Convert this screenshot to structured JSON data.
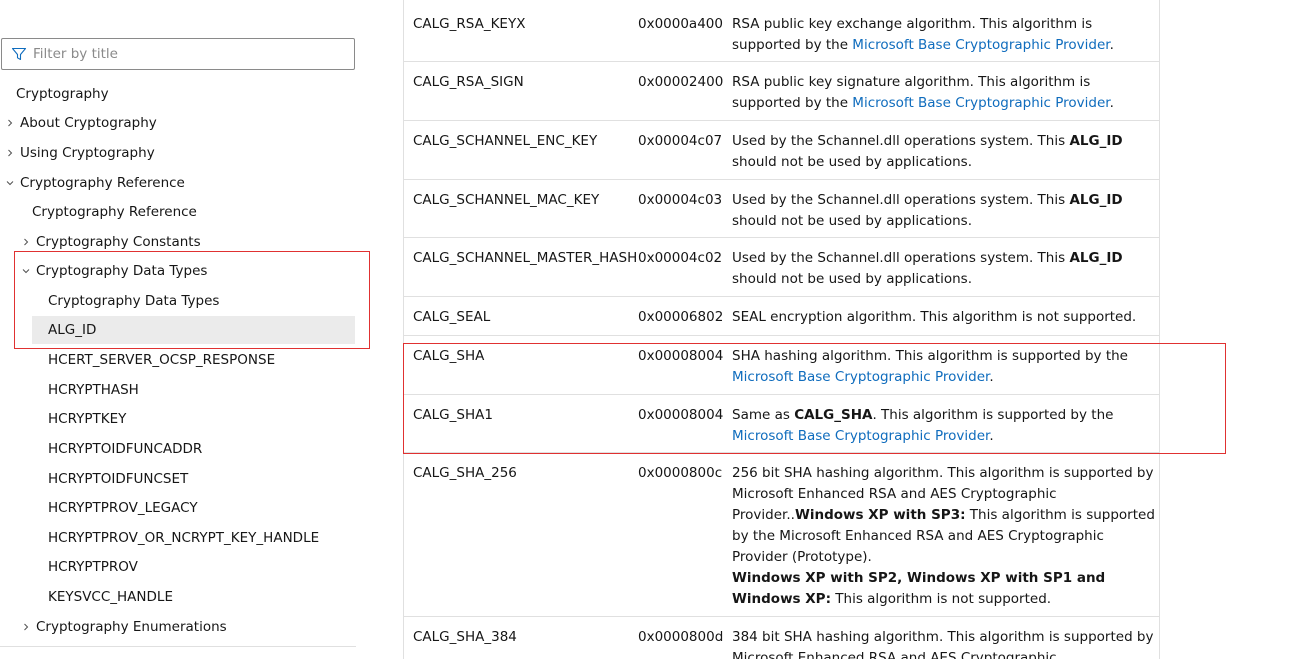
{
  "sidebar": {
    "filter_placeholder": "Filter by title",
    "items": [
      {
        "label": "Cryptography",
        "chevron": "none"
      },
      {
        "label": "About Cryptography",
        "chevron": "right"
      },
      {
        "label": "Using Cryptography",
        "chevron": "right"
      },
      {
        "label": "Cryptography Reference",
        "chevron": "down"
      },
      {
        "label": "Cryptography Reference",
        "chevron": "none"
      },
      {
        "label": "Cryptography Constants",
        "chevron": "right"
      },
      {
        "label": "Cryptography Data Types",
        "chevron": "down"
      },
      {
        "label": "Cryptography Data Types",
        "chevron": "none"
      },
      {
        "label": "ALG_ID",
        "chevron": "none",
        "selected": true
      },
      {
        "label": "HCERT_SERVER_OCSP_RESPONSE",
        "chevron": "none"
      },
      {
        "label": "HCRYPTHASH",
        "chevron": "none"
      },
      {
        "label": "HCRYPTKEY",
        "chevron": "none"
      },
      {
        "label": "HCRYPTOIDFUNCADDR",
        "chevron": "none"
      },
      {
        "label": "HCRYPTOIDFUNCSET",
        "chevron": "none"
      },
      {
        "label": "HCRYPTPROV_LEGACY",
        "chevron": "none"
      },
      {
        "label": "HCRYPTPROV_OR_NCRYPT_KEY_HANDLE",
        "chevron": "none"
      },
      {
        "label": "HCRYPTPROV",
        "chevron": "none"
      },
      {
        "label": "KEYSVCC_HANDLE",
        "chevron": "none"
      },
      {
        "label": "Cryptography Enumerations",
        "chevron": "right"
      }
    ]
  },
  "table": {
    "rows": [
      {
        "name": "CALG_RSA_KEYX",
        "value": "0x0000a400",
        "desc": [
          {
            "t": "RSA public key exchange algorithm. This algorithm is supported by the "
          },
          {
            "t": "Microsoft Base Cryptographic Provider",
            "link": true
          },
          {
            "t": "."
          }
        ]
      },
      {
        "name": "CALG_RSA_SIGN",
        "value": "0x00002400",
        "desc": [
          {
            "t": "RSA public key signature algorithm. This algorithm is supported by the "
          },
          {
            "t": "Microsoft Base Cryptographic Provider",
            "link": true
          },
          {
            "t": "."
          }
        ]
      },
      {
        "name": "CALG_SCHANNEL_ENC_KEY",
        "value": "0x00004c07",
        "desc": [
          {
            "t": "Used by the Schannel.dll operations system. This "
          },
          {
            "t": "ALG_ID",
            "bold": true
          },
          {
            "t": " should not be used by applications."
          }
        ]
      },
      {
        "name": "CALG_SCHANNEL_MAC_KEY",
        "value": "0x00004c03",
        "desc": [
          {
            "t": "Used by the Schannel.dll operations system. This "
          },
          {
            "t": "ALG_ID",
            "bold": true
          },
          {
            "t": " should not be used by applications."
          }
        ]
      },
      {
        "name": "CALG_SCHANNEL_MASTER_HASH",
        "value": "0x00004c02",
        "desc": [
          {
            "t": "Used by the Schannel.dll operations system. This "
          },
          {
            "t": "ALG_ID",
            "bold": true
          },
          {
            "t": " should not be used by applications."
          }
        ]
      },
      {
        "name": "CALG_SEAL",
        "value": "0x00006802",
        "desc": [
          {
            "t": "SEAL encryption algorithm. This algorithm is not supported."
          }
        ]
      },
      {
        "name": "CALG_SHA",
        "value": "0x00008004",
        "desc": [
          {
            "t": "SHA hashing algorithm. This algorithm is supported by the "
          },
          {
            "t": "Microsoft Base Cryptographic Provider",
            "link": true
          },
          {
            "t": "."
          }
        ]
      },
      {
        "name": "CALG_SHA1",
        "value": "0x00008004",
        "desc": [
          {
            "t": "Same as "
          },
          {
            "t": "CALG_SHA",
            "bold": true
          },
          {
            "t": ". This algorithm is supported by the "
          },
          {
            "t": "Microsoft Base Cryptographic Provider",
            "link": true
          },
          {
            "t": "."
          }
        ]
      },
      {
        "name": "CALG_SHA_256",
        "value": "0x0000800c",
        "desc": [
          {
            "t": "256 bit SHA hashing algorithm. This algorithm is supported by Microsoft Enhanced RSA and AES Cryptographic Provider.."
          },
          {
            "t": "Windows XP with SP3:",
            "bold": true
          },
          {
            "t": " This algorithm is supported by the Microsoft Enhanced RSA and AES Cryptographic Provider (Prototype)."
          },
          {
            "br": true
          },
          {
            "t": "Windows XP with SP2, Windows XP with SP1 and Windows XP:",
            "bold": true
          },
          {
            "t": " This algorithm is not supported."
          }
        ]
      },
      {
        "name": "CALG_SHA_384",
        "value": "0x0000800d",
        "desc": [
          {
            "t": "384 bit SHA hashing algorithm. This algorithm is supported by Microsoft Enhanced RSA and AES Cryptographic"
          }
        ]
      }
    ]
  },
  "colors": {
    "link": "#0f6cbd",
    "highlight_border": "#e03131",
    "selected_bg": "#ebebeb"
  }
}
